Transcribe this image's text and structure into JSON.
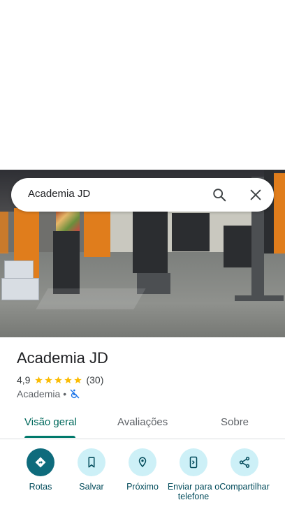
{
  "search": {
    "query": "Academia JD"
  },
  "place": {
    "name": "Academia JD",
    "rating": "4,9",
    "stars": 5,
    "review_count": "(30)",
    "category": "Academia",
    "separator": "•",
    "accessibility_icon": "wheelchair-not-accessible-icon"
  },
  "tabs": [
    {
      "label": "Visão geral",
      "active": true
    },
    {
      "label": "Avaliações",
      "active": false
    },
    {
      "label": "Sobre",
      "active": false
    }
  ],
  "actions": [
    {
      "label": "Rotas",
      "icon": "directions-icon"
    },
    {
      "label": "Salvar",
      "icon": "bookmark-icon"
    },
    {
      "label": "Próximo",
      "icon": "nearby-icon"
    },
    {
      "label": "Enviar para o telefone",
      "icon": "send-to-phone-icon"
    },
    {
      "label": "Compartilhar",
      "icon": "share-icon"
    }
  ],
  "colors": {
    "accent": "#00796b",
    "primary_action": "#0e6b7c",
    "secondary_action_bg": "#cdf0f7",
    "star": "#fbbc04",
    "orange_pillar": "#e07d1c"
  }
}
